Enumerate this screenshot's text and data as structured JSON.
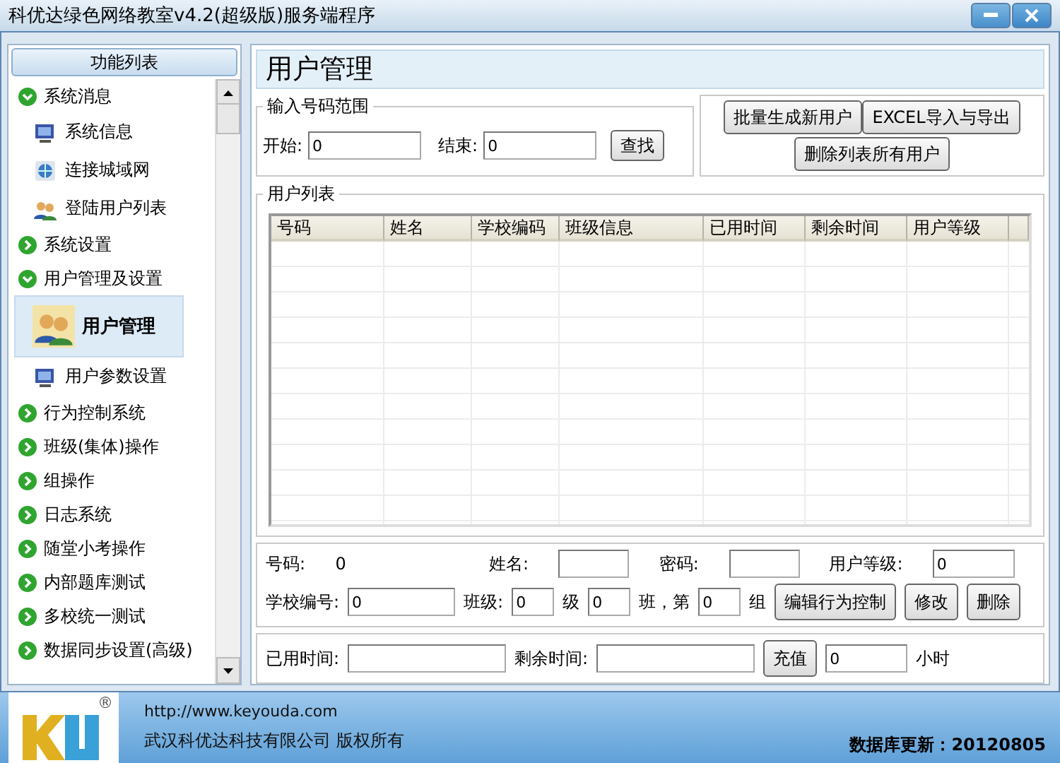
{
  "window": {
    "title": "科优达绿色网络教室v4.2(超级版)服务端程序"
  },
  "sidebar": {
    "title": "功能列表",
    "items": [
      {
        "kind": "group",
        "label": "系统消息",
        "expanded": true,
        "selected": false
      },
      {
        "kind": "monitor",
        "label": "系统信息",
        "selected": false
      },
      {
        "kind": "globe",
        "label": "连接城域网",
        "selected": false
      },
      {
        "kind": "users",
        "label": "登陆用户列表",
        "selected": false
      },
      {
        "kind": "group",
        "label": "系统设置",
        "expanded": false,
        "selected": false
      },
      {
        "kind": "group",
        "label": "用户管理及设置",
        "expanded": true,
        "selected": false
      },
      {
        "kind": "users",
        "label": "用户管理",
        "selected": true
      },
      {
        "kind": "monitor",
        "label": "用户参数设置",
        "selected": false
      },
      {
        "kind": "group",
        "label": "行为控制系统",
        "expanded": false,
        "selected": false
      },
      {
        "kind": "group",
        "label": "班级(集体)操作",
        "expanded": false,
        "selected": false
      },
      {
        "kind": "group",
        "label": "组操作",
        "expanded": false,
        "selected": false
      },
      {
        "kind": "group",
        "label": "日志系统",
        "expanded": false,
        "selected": false
      },
      {
        "kind": "group",
        "label": "随堂小考操作",
        "expanded": false,
        "selected": false
      },
      {
        "kind": "group",
        "label": "内部题库测试",
        "expanded": false,
        "selected": false
      },
      {
        "kind": "group",
        "label": "多校统一测试",
        "expanded": false,
        "selected": false
      },
      {
        "kind": "group",
        "label": "数据同步设置(高级)",
        "expanded": false,
        "selected": false
      }
    ]
  },
  "page_title": "用户管理",
  "range": {
    "legend": "输入号码范围",
    "start_label": "开始:",
    "start_value": "0",
    "end_label": "结束:",
    "end_value": "0",
    "button": "查找"
  },
  "actions": [
    "批量生成新用户",
    "EXCEL导入与导出",
    "删除列表所有用户"
  ],
  "user_list": {
    "legend": "用户列表",
    "columns": [
      "号码",
      "姓名",
      "学校编码",
      "班级信息",
      "已用时间",
      "剩余时间",
      "用户等级"
    ]
  },
  "details": [
    [
      {
        "kind": "label",
        "text": "号码:"
      },
      {
        "kind": "value",
        "text": "0"
      },
      {
        "kind": "label",
        "text": "姓名:"
      },
      {
        "kind": "input"
      },
      {
        "kind": "label",
        "text": "密码:"
      },
      {
        "kind": "input"
      },
      {
        "kind": "label",
        "text": "用户等级:"
      },
      {
        "kind": "input",
        "value": "0"
      }
    ],
    [
      {
        "kind": "label",
        "text": "学校编号:"
      },
      {
        "kind": "input",
        "value": "0"
      },
      {
        "kind": "label",
        "text": "班级:"
      },
      {
        "kind": "short",
        "value": "0"
      },
      {
        "kind": "label",
        "text": "级"
      },
      {
        "kind": "short",
        "value": "0"
      },
      {
        "kind": "label",
        "text": "班，第"
      },
      {
        "kind": "short",
        "value": "0"
      },
      {
        "kind": "label",
        "text": "组"
      },
      {
        "kind": "button",
        "text": "编辑行为控制"
      },
      {
        "kind": "button",
        "text": "修改"
      },
      {
        "kind": "button",
        "text": "删除"
      }
    ]
  ],
  "time_row": [
    {
      "kind": "label",
      "text": "已用时间:"
    },
    {
      "kind": "wide"
    },
    {
      "kind": "label",
      "text": "剩余时间:"
    },
    {
      "kind": "wide"
    },
    {
      "kind": "button",
      "text": "充值"
    },
    {
      "kind": "input",
      "value": "0"
    },
    {
      "kind": "label",
      "text": "小时"
    }
  ],
  "footer": {
    "logo_mark": "®",
    "url": "http://www.keyouda.com",
    "company": "武汉科优达科技有限公司 版权所有",
    "db_update": "数据库更新：20120805"
  }
}
